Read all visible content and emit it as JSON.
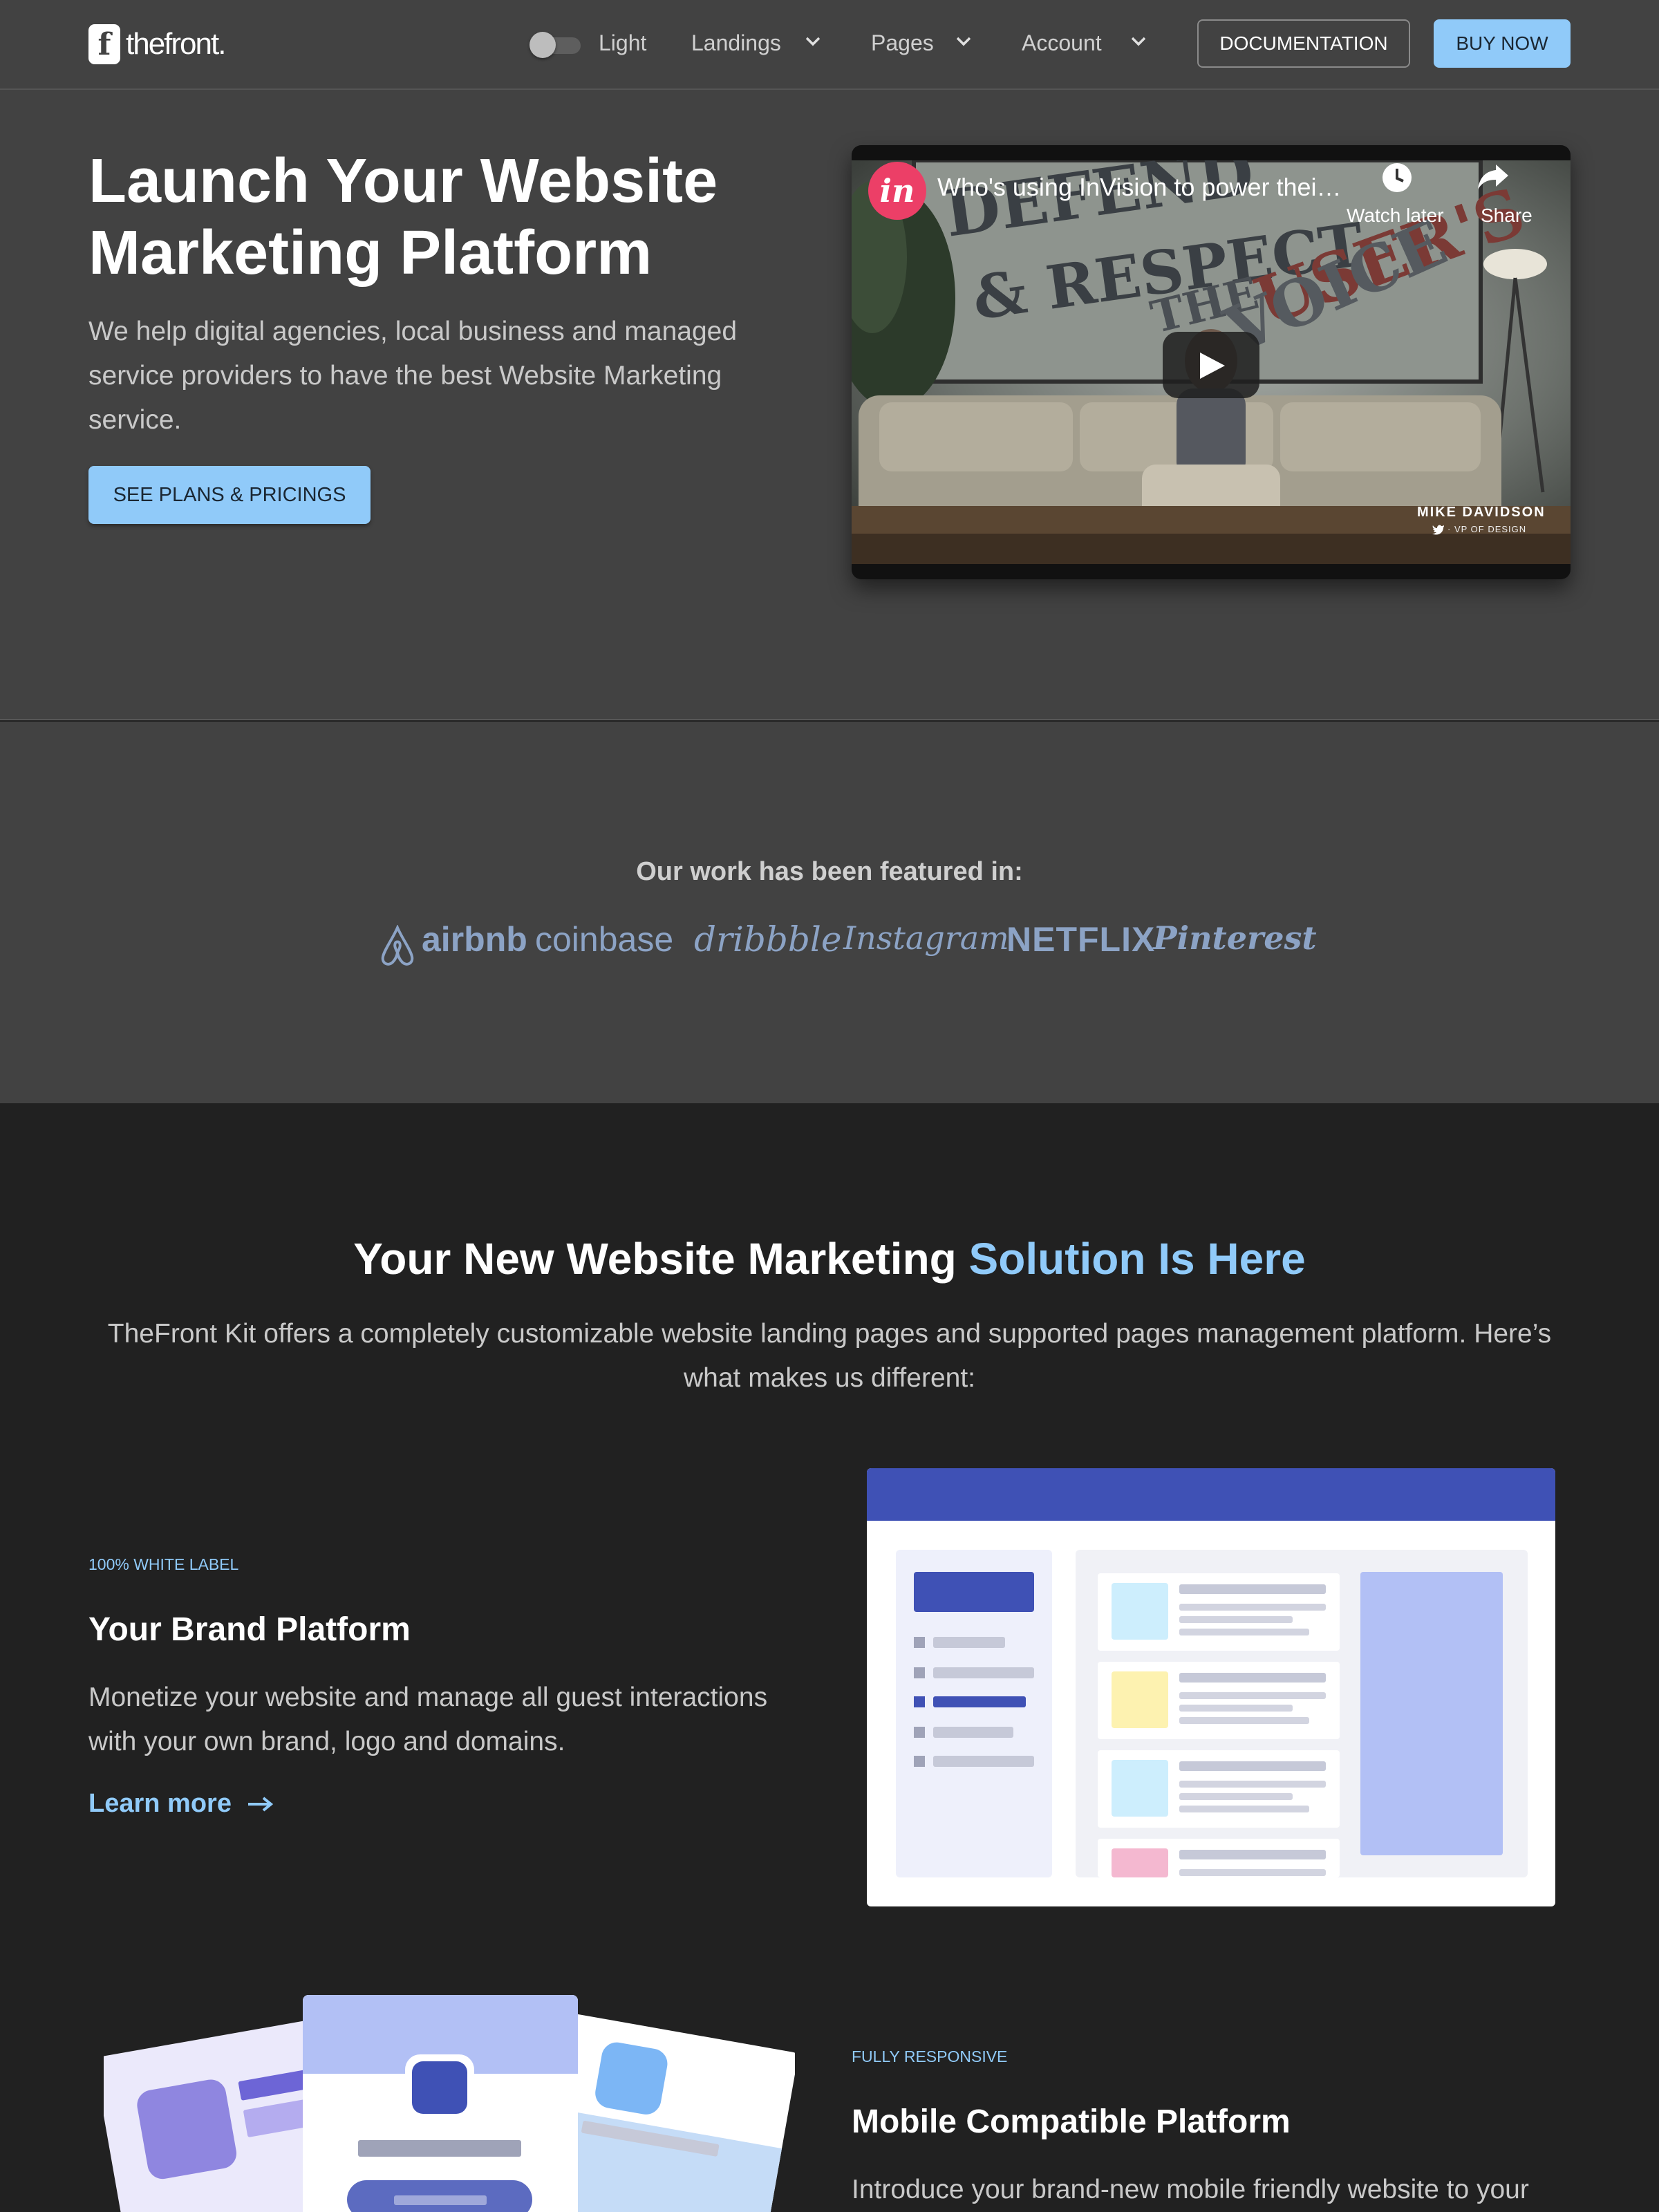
{
  "header": {
    "logo_mark": "f",
    "logo_text": "thefront.",
    "theme_label": "Light",
    "nav": [
      {
        "label": "Landings"
      },
      {
        "label": "Pages"
      },
      {
        "label": "Account"
      }
    ],
    "documentation_label": "DOCUMENTATION",
    "buy_label": "BUY NOW"
  },
  "hero": {
    "title": "Launch Your Website Marketing Platform",
    "subtitle": "We help digital agencies, local business and managed service providers to have the best Website Marketing service.",
    "cta_label": "SEE PLANS & PRICINGS",
    "video": {
      "channel_logo": "in",
      "title": "Who's using InVision to power thei…",
      "watch_later": "Watch later",
      "share": "Share",
      "credit_name": "MIKE DAVIDSON",
      "credit_role": "· VP OF DESIGN",
      "poster_words": [
        "DEFEND",
        "& RESPECT",
        "THE",
        "USER'S",
        "VOICE"
      ]
    }
  },
  "featured": {
    "title": "Our work has been featured in:",
    "brands": [
      "airbnb",
      "coinbase",
      "dribbble",
      "Instagram",
      "NETFLIX",
      "Pinterest"
    ]
  },
  "solution": {
    "title_main": "Your New Website Marketing",
    "title_highlight": "Solution Is Here",
    "description": "TheFront Kit offers a completely customizable website landing pages and supported pages management platform. Here’s what makes us different:"
  },
  "features": [
    {
      "eyebrow": "100% WHITE LABEL",
      "title": "Your Brand Platform",
      "description": "Monetize your website and manage all guest interactions with your own brand, logo and domains.",
      "link_label": "Learn more"
    },
    {
      "eyebrow": "FULLY RESPONSIVE",
      "title": "Mobile Compatible Platform",
      "description": "Introduce your brand-new mobile friendly website to your"
    }
  ],
  "colors": {
    "accent": "#90caf9",
    "header_bg": "#424242",
    "dark_bg": "#212121",
    "mock_primary": "#3f51b5"
  },
  "icons": [
    "toggle-switch",
    "chevron-down-icon",
    "play-icon",
    "clock-icon",
    "share-icon",
    "arrow-right-icon",
    "twitter-icon"
  ]
}
